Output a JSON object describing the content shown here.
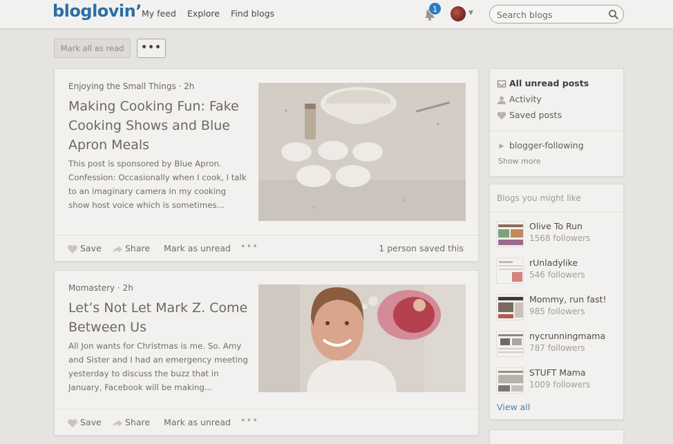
{
  "header": {
    "logo": "bloglovin’",
    "nav": [
      "My feed",
      "Explore",
      "Find blogs"
    ],
    "notification_count": "1",
    "search_placeholder": "Search blogs"
  },
  "toolbar": {
    "mark_all_label": "Mark all as read",
    "more_label": "•••"
  },
  "posts": [
    {
      "source": "Enjoying the Small Things · 2h",
      "title": "Making Cooking Fun: Fake Cooking Shows and Blue Apron Meals",
      "excerpt": "This post is sponsored by Blue Apron. Confession: Occasionally when I cook, I talk to an imaginary camera in my cooking show host voice which is sometimes...",
      "save": "Save",
      "share": "Share",
      "mark_unread": "Mark as unread",
      "more": "•••",
      "saved_count": "1 person saved this"
    },
    {
      "source": "Momastery · 2h",
      "title": "Let’s Not Let Mark Z. Come Between Us",
      "excerpt": "All Jon wants for Christmas is me. So. Amy and Sister and I had an emergency meeting yesterday to discuss the buzz that in January, Facebook will be making...",
      "save": "Save",
      "share": "Share",
      "mark_unread": "Mark as unread",
      "more": "•••"
    }
  ],
  "sidebar": {
    "items": [
      {
        "label": "All unread posts",
        "icon": "inbox-icon"
      },
      {
        "label": "Activity",
        "icon": "person-icon"
      },
      {
        "label": "Saved posts",
        "icon": "heart-icon"
      }
    ],
    "folder": "blogger-following",
    "show_more": "Show more",
    "blogs_heading": "Blogs you might like",
    "blogs": [
      {
        "name": "Olive To Run",
        "followers": "1568 followers"
      },
      {
        "name": "rUnladylike",
        "followers": "546 followers"
      },
      {
        "name": "Mommy, run fast!",
        "followers": "985 followers"
      },
      {
        "name": "nycrunningmama",
        "followers": "787 followers"
      },
      {
        "name": "STUFT Mama",
        "followers": "1009 followers"
      }
    ],
    "view_all": "View all"
  },
  "colors": {
    "brand": "#2b6ea5",
    "badge": "#2e7bc4",
    "background": "#e6e4e1",
    "card": "#f2f1ef"
  }
}
